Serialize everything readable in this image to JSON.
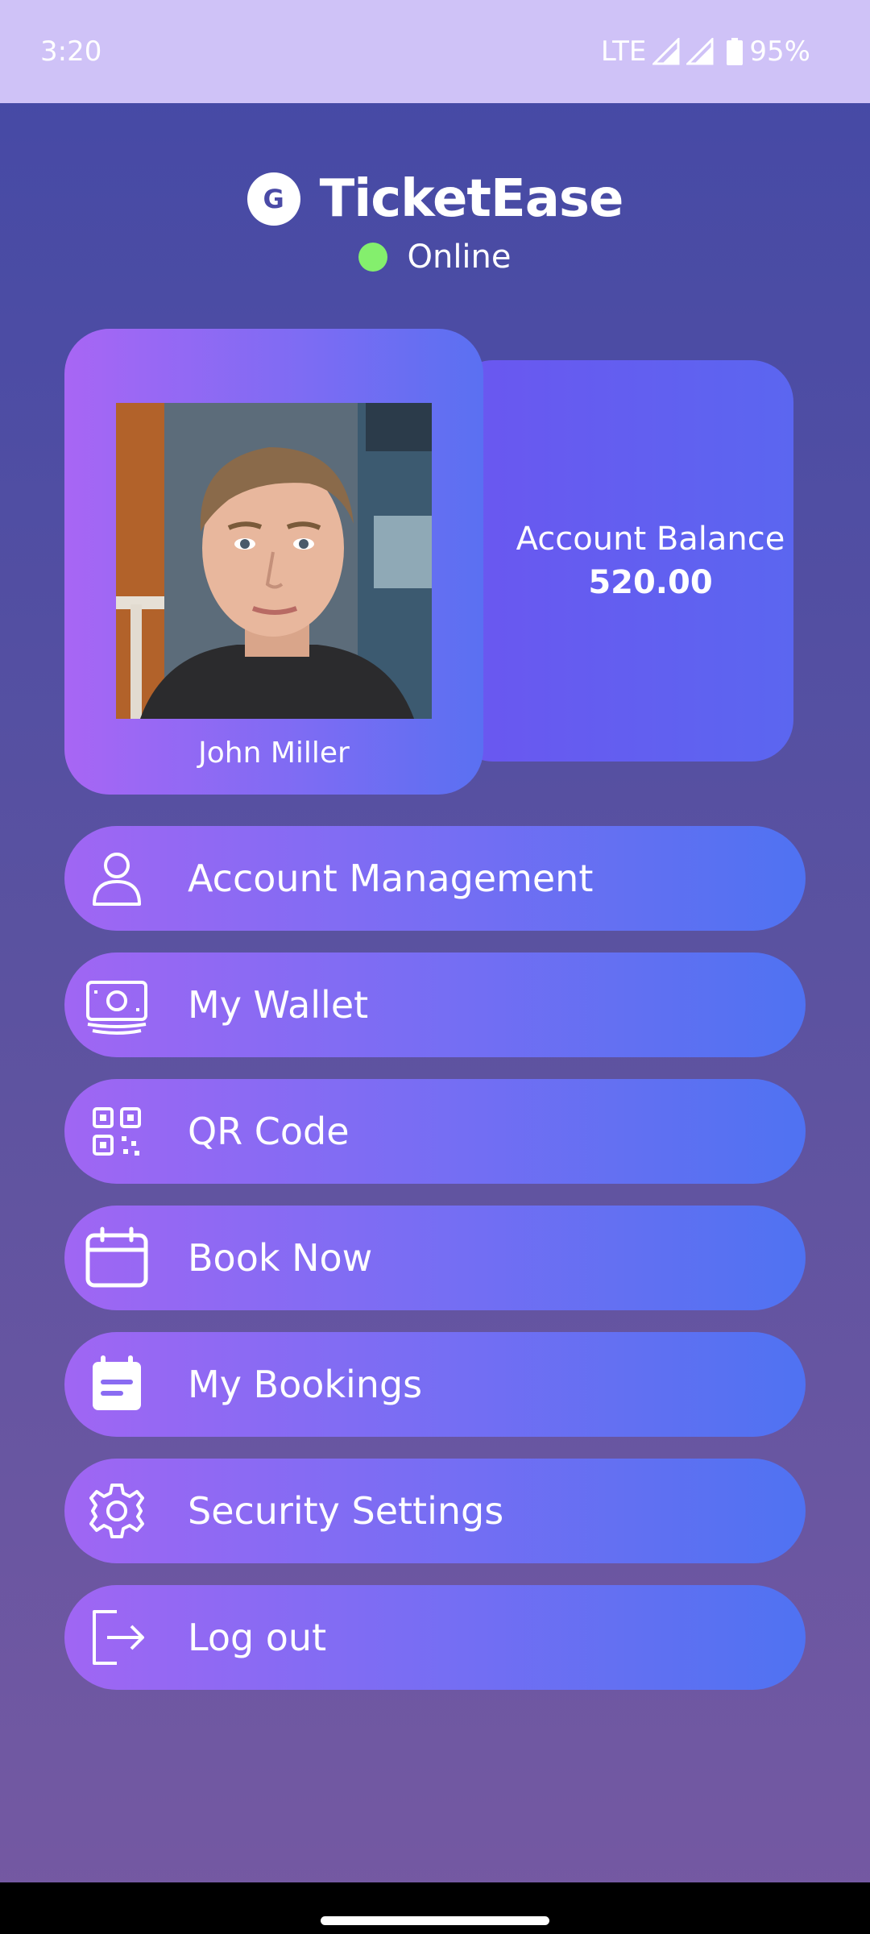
{
  "status_bar": {
    "time": "3:20",
    "network": "LTE",
    "battery": "95%"
  },
  "header": {
    "logo_letter": "G",
    "app_name": "TicketEase",
    "status": "Online",
    "status_color": "#84ef6d"
  },
  "profile": {
    "name": "John Miller"
  },
  "balance": {
    "label": "Account Balance",
    "value": "520.00"
  },
  "menu": [
    {
      "label": "Account Management",
      "icon": "user-icon"
    },
    {
      "label": "My Wallet",
      "icon": "wallet-icon"
    },
    {
      "label": "QR Code",
      "icon": "qr-code-icon"
    },
    {
      "label": "Book Now",
      "icon": "calendar-icon"
    },
    {
      "label": "My Bookings",
      "icon": "bookings-icon"
    },
    {
      "label": "Security Settings",
      "icon": "gear-icon"
    },
    {
      "label": "Log out",
      "icon": "logout-icon"
    }
  ],
  "colors": {
    "status_bar": "#cfc2f7",
    "background_top": "#4449a6",
    "background_bottom": "#7559a2",
    "button_gradient_start": "#a066f3",
    "button_gradient_end": "#4f72f2"
  }
}
